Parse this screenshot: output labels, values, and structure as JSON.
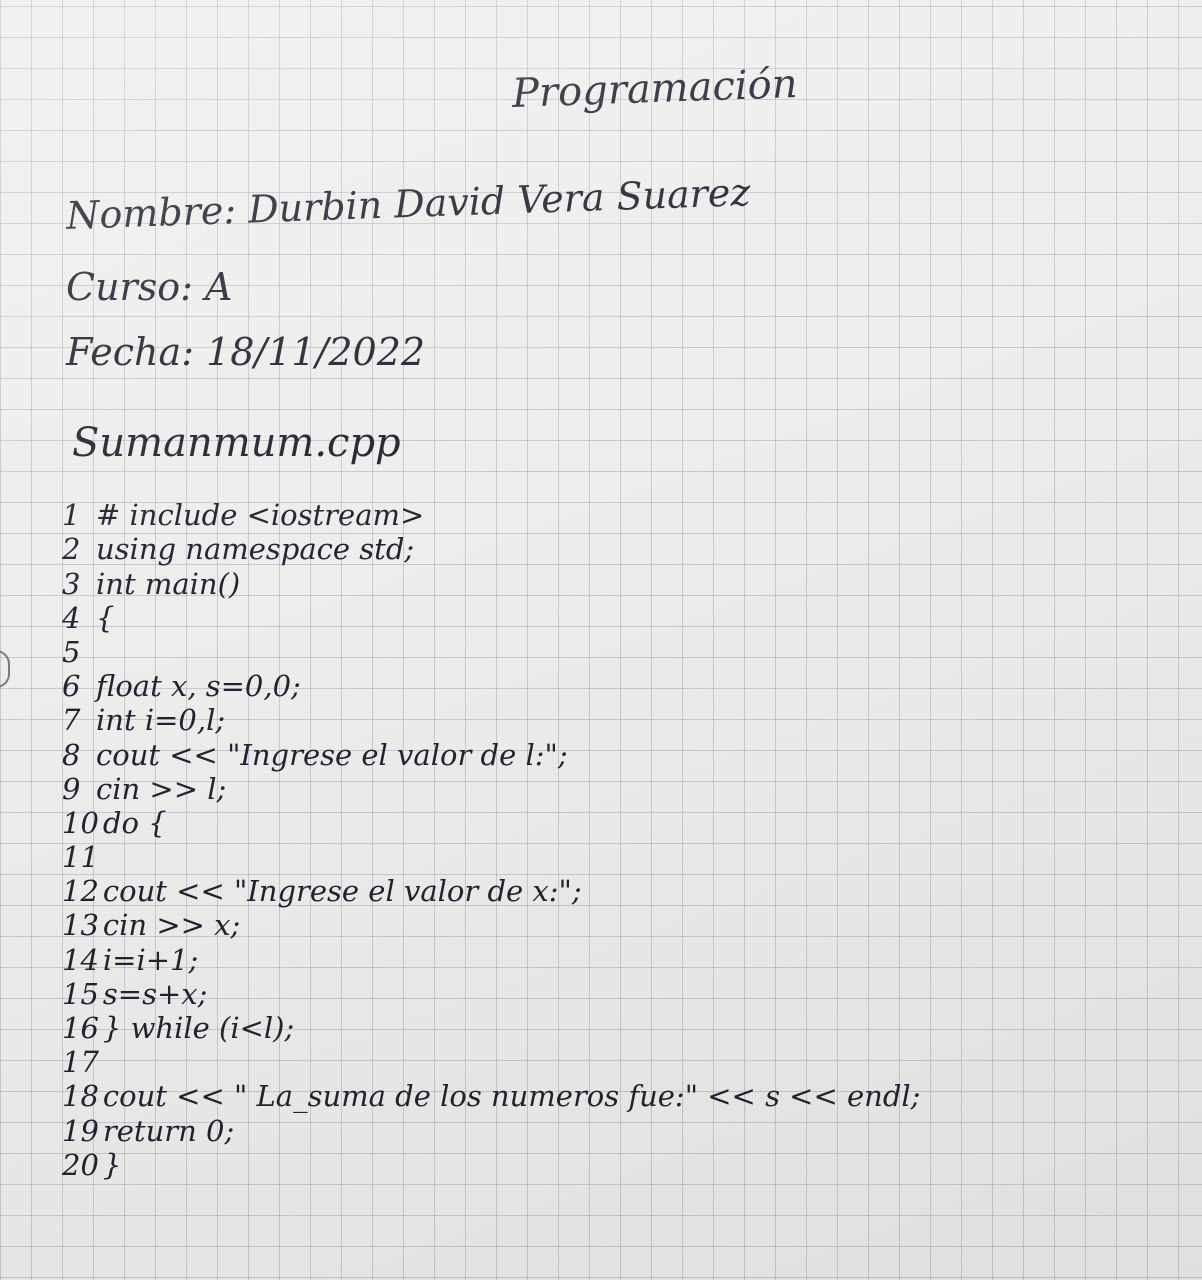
{
  "title": "Programación",
  "header": {
    "name_line": "Nombre: Durbin David Vera Suarez",
    "course_line": "Curso: A",
    "date_line": "Fecha: 18/11/2022"
  },
  "filename": "Sumanmum.cpp",
  "code_lines": [
    {
      "n": "1",
      "text": "# include <iostream>"
    },
    {
      "n": "2",
      "text": "using namespace std;"
    },
    {
      "n": "3",
      "text": "int main()"
    },
    {
      "n": "4",
      "text": "{"
    },
    {
      "n": "5",
      "text": ""
    },
    {
      "n": "6",
      "text": "float x, s=0,0;"
    },
    {
      "n": "7",
      "text": "int i=0,l;"
    },
    {
      "n": "8",
      "text": "cout << \"Ingrese el valor de l:\";"
    },
    {
      "n": "9",
      "text": "cin >> l;"
    },
    {
      "n": "10",
      "text": "do {"
    },
    {
      "n": "11",
      "text": ""
    },
    {
      "n": "12",
      "text": "cout << \"Ingrese el valor de x:\";"
    },
    {
      "n": "13",
      "text": "cin >> x;"
    },
    {
      "n": "14",
      "text": "i=i+1;"
    },
    {
      "n": "15",
      "text": "s=s+x;"
    },
    {
      "n": "16",
      "text": "} while (i<l);"
    },
    {
      "n": "17",
      "text": ""
    },
    {
      "n": "18",
      "text": "cout << \" La_suma de los numeros fue:\" << s << endl;"
    },
    {
      "n": "19",
      "text": "return 0;"
    },
    {
      "n": "20",
      "text": "}"
    }
  ]
}
